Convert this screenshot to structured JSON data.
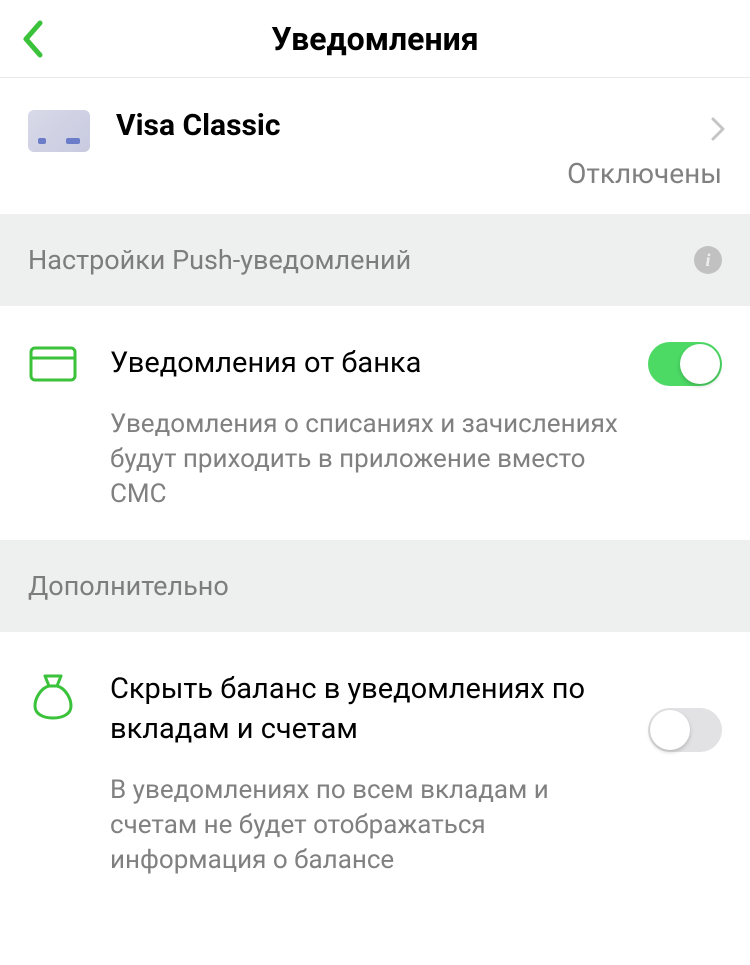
{
  "header": {
    "title": "Уведомления"
  },
  "card": {
    "name": "Visa Classic",
    "status": "Отключены"
  },
  "sections": {
    "push": {
      "title": "Настройки Push-уведомлений"
    },
    "additional": {
      "title": "Дополнительно"
    }
  },
  "settings": {
    "bank": {
      "title": "Уведомления от банка",
      "desc": "Уведомления о списаниях и зачислениях будут приходить в приложение вместо СМС",
      "enabled": true
    },
    "hideBalance": {
      "title": "Скрыть баланс в уведомлениях по вкладам и счетам",
      "desc": "В уведомлениях по всем вкладам и счетам не будет отображаться информация о балансе",
      "enabled": false
    }
  },
  "colors": {
    "accent": "#3ac23a",
    "toggleOn": "#4cd964"
  }
}
